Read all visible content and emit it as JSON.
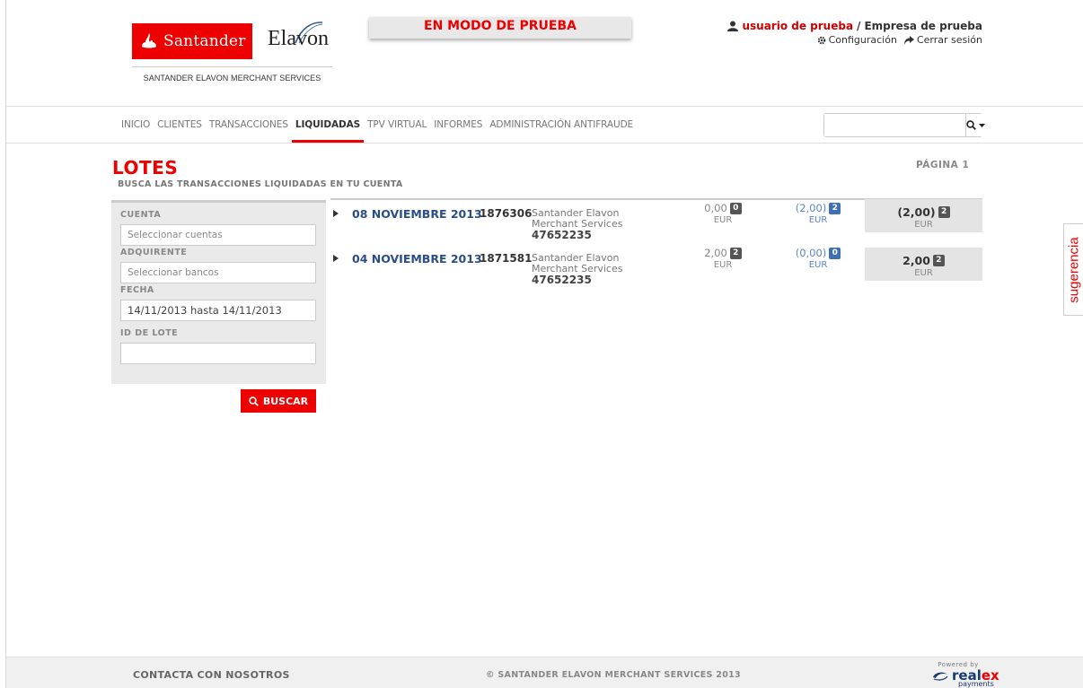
{
  "header": {
    "brand_santander": "Santander",
    "brand_elavon": "Elavon",
    "brand_subtitle": "SANTANDER ELAVON MERCHANT SERVICES",
    "test_mode_banner": "EN MODO DE PRUEBA",
    "user": {
      "username": "usuario de prueba",
      "separator": " / ",
      "company": "Empresa de prueba",
      "config_label": "Configuración",
      "logout_label": "Cerrar sesión"
    }
  },
  "nav": {
    "items": [
      {
        "label": "INICIO",
        "active": false
      },
      {
        "label": "CLIENTES",
        "active": false
      },
      {
        "label": "TRANSACCIONES",
        "active": false
      },
      {
        "label": "LIQUIDADAS",
        "active": true
      },
      {
        "label": "TPV VIRTUAL",
        "active": false
      },
      {
        "label": "INFORMES",
        "active": false
      },
      {
        "label": "ADMINISTRACIÓN ANTIFRAUDE",
        "active": false
      }
    ],
    "search_value": ""
  },
  "page": {
    "title": "LOTES",
    "subtitle": "BUSCA LAS TRANSACCIONES LIQUIDADAS EN TU CUENTA",
    "page_label": "PÁGINA 1"
  },
  "filters": {
    "cuenta_label": "CUENTA",
    "cuenta_placeholder": "Seleccionar cuentas",
    "adquirente_label": "ADQUIRENTE",
    "adquirente_placeholder": "Seleccionar bancos",
    "fecha_label": "FECHA",
    "fecha_value": "14/11/2013 hasta 14/11/2013",
    "lote_label": "ID DE LOTE",
    "lote_value": "",
    "search_button": "BUSCAR"
  },
  "results": [
    {
      "date": "08 NOVIEMBRE 2013",
      "batch_id": "1876306",
      "merchant_line1": "Santander Elavon",
      "merchant_line2": "Merchant Services",
      "merchant_id": "47652235",
      "amount1": "0,00",
      "amount1_count": "0",
      "amount1_currency": "EUR",
      "amount2": "(2,00)",
      "amount2_count": "2",
      "amount2_currency": "EUR",
      "total": "(2,00)",
      "total_count": "2",
      "total_currency": "EUR"
    },
    {
      "date": "04 NOVIEMBRE 2013",
      "batch_id": "1871581",
      "merchant_line1": "Santander Elavon",
      "merchant_line2": "Merchant Services",
      "merchant_id": "47652235",
      "amount1": "2,00",
      "amount1_count": "2",
      "amount1_currency": "EUR",
      "amount2": "(0,00)",
      "amount2_count": "0",
      "amount2_currency": "EUR",
      "total": "2,00",
      "total_count": "2",
      "total_currency": "EUR"
    }
  ],
  "side_tab": "sugerencia",
  "footer": {
    "contact": "CONTACTA CON NOSOTROS",
    "copyright": "© SANTANDER ELAVON MERCHANT SERVICES 2013",
    "powered_by": "Powered by",
    "realex_a": "real",
    "realex_b": "ex",
    "realex_payments": "payments"
  },
  "colors": {
    "brand_red": "#ec0000",
    "link_blue": "#2a4d8a",
    "badge_blue": "#3f6fb5"
  }
}
